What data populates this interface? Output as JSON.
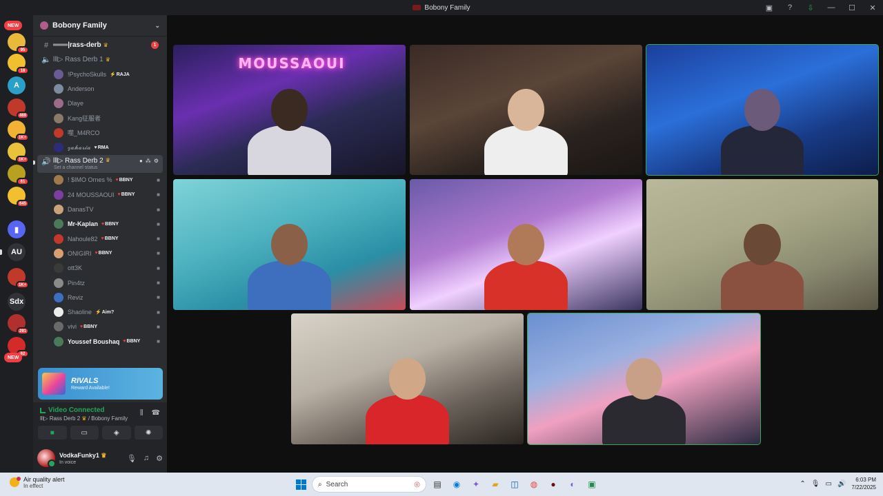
{
  "window": {
    "title": "Bobony Family",
    "colors": {
      "accent": "#23a55a",
      "danger": "#f23f43",
      "background": "#1e1f22",
      "sidebar": "#2b2d31"
    }
  },
  "rail": {
    "new_top": "NEW",
    "new_bottom": "NEW",
    "servers": [
      {
        "badge": "95"
      },
      {
        "badge": "18"
      },
      {
        "letter": "A"
      },
      {
        "badge": "469"
      },
      {
        "badge": "1K+"
      },
      {
        "badge": "1K+"
      },
      {
        "badge": "61"
      },
      {
        "badge": "645"
      },
      {
        "icon": "folder-icon"
      },
      {
        "letter": "AU"
      },
      {
        "badge": "1K+"
      },
      {
        "letter": "Sdx"
      },
      {
        "badge": "291"
      },
      {
        "badge": "62"
      }
    ]
  },
  "guild": {
    "name": "Bobony Family"
  },
  "channels": {
    "text_channel": {
      "name": "═══|rass-derb",
      "unread": "1"
    },
    "voice1": {
      "name": "lll▷ Rass Derb 1"
    },
    "voice1_users": [
      {
        "name": "!PsychoSkulls",
        "tag": "RAJA",
        "tag_icon": "⚡",
        "color": "#6b5b95"
      },
      {
        "name": "Anderson",
        "color": "#7d8ba0"
      },
      {
        "name": "Dlaye",
        "color": "#9b6b8a"
      },
      {
        "name": "Kang征服者",
        "color": "#8a7a6a"
      },
      {
        "name": "噬_M4RCO",
        "color": "#c0392b"
      },
      {
        "name": "𝔃𝓪𝓱𝓪𝓻𝓲𝓪",
        "tag": "RMA",
        "tag_icon": "♥",
        "color": "#2c2c7a"
      }
    ],
    "voice2": {
      "name": "lll▷ Rass Derb 2",
      "status": "Set a channel status"
    },
    "voice2_users": [
      {
        "name": "! $IMO Ornes %",
        "tag": "BBNY",
        "color": "#a07a4a"
      },
      {
        "name": "24 MOUSSAOUI",
        "tag": "BBNY",
        "color": "#7b3fa0"
      },
      {
        "name": "DanasTV",
        "color": "#c9a27b"
      },
      {
        "name": "Mr-Kaplan",
        "tag": "BBNY",
        "bold": true,
        "color": "#4a7a5a"
      },
      {
        "name": "Nahoule82",
        "tag": "BBNY",
        "color": "#c0392b"
      },
      {
        "name": "ONIGIRI",
        "tag": "BBNY",
        "color": "#d8a070"
      },
      {
        "name": "ott3K",
        "color": "#3a3a3a"
      },
      {
        "name": "Pin4tz",
        "color": "#8a8a8a"
      },
      {
        "name": "Reviz",
        "color": "#3e6fbf"
      },
      {
        "name": "Shaoline",
        "tag": "Aim?",
        "tag_icon": "⚡",
        "color": "#ececec"
      },
      {
        "name": "vivi",
        "tag": "BBNY",
        "color": "#6a6a6a"
      },
      {
        "name": "Youssef Boushaq",
        "tag": "BBNY",
        "bold": true,
        "color": "#4a7a5a"
      }
    ]
  },
  "promo": {
    "brand": "RIVALS",
    "text": "Reward Available!"
  },
  "voice_panel": {
    "status": "Video Connected",
    "channel": "lll▷ Rass Derb 2",
    "guild": "/ Bobony Family"
  },
  "user_panel": {
    "name": "VodkaFunky1",
    "status": "In voice"
  },
  "stage": {
    "tiles": [
      {
        "sign": "MOUSSAOUI",
        "bg": "linear-gradient(160deg,#2a1f5c 0%,#6a2fb0 35%,#2b2b55 60%,#171526 100%)",
        "head": "#3a2a22",
        "body": "#d8d6df",
        "speaking": false
      },
      {
        "bg": "linear-gradient(160deg,#3a2a26 0%,#5a4538 40%,#2a221e 70%,#1a1614 100%)",
        "head": "#d9b59a",
        "body": "#eeeeee",
        "speaking": false
      },
      {
        "bg": "linear-gradient(160deg,#1b3f9c 0%,#2b6fd9 40%,#183a85 70%,#0d1d4a 100%)",
        "head": "#6b5a7a",
        "body": "#24273a",
        "speaking": true
      },
      {
        "bg": "linear-gradient(160deg,#7fd3d8 0%,#4fb3c0 40%,#2a8fa6 70%,#c84b5a 100%)",
        "head": "#8a6048",
        "body": "#3e6fbf",
        "speaking": false
      },
      {
        "bg": "linear-gradient(160deg,#6a5aa8 0%,#b07ad0 40%,#f0d0ff 60%,#3a3560 100%)",
        "head": "#b07a58",
        "body": "#d8312a",
        "speaking": false
      },
      {
        "bg": "linear-gradient(160deg,#b9b89a 0%,#a8a888 40%,#8a8a70 70%,#5a5545 100%)",
        "head": "#6a4a36",
        "body": "#8a5040",
        "speaking": false
      },
      {
        "bg": "linear-gradient(160deg,#d8d2c8 0%,#b8b0a4 40%,#6a625a 70%,#2a2520 100%)",
        "head": "#d0a888",
        "body": "#d8262a",
        "speaking": false
      },
      {
        "bg": "linear-gradient(160deg,#6a8fd0 0%,#9ab0e0 35%,#f0a0c0 55%,#2a2a40 100%)",
        "head": "#c8a088",
        "body": "#2a2a30",
        "speaking": true
      }
    ]
  },
  "taskbar": {
    "alert_title": "Air quality alert",
    "alert_sub": "In effect",
    "search_placeholder": "Search",
    "time": "6:03 PM",
    "date": "7/22/2025"
  }
}
